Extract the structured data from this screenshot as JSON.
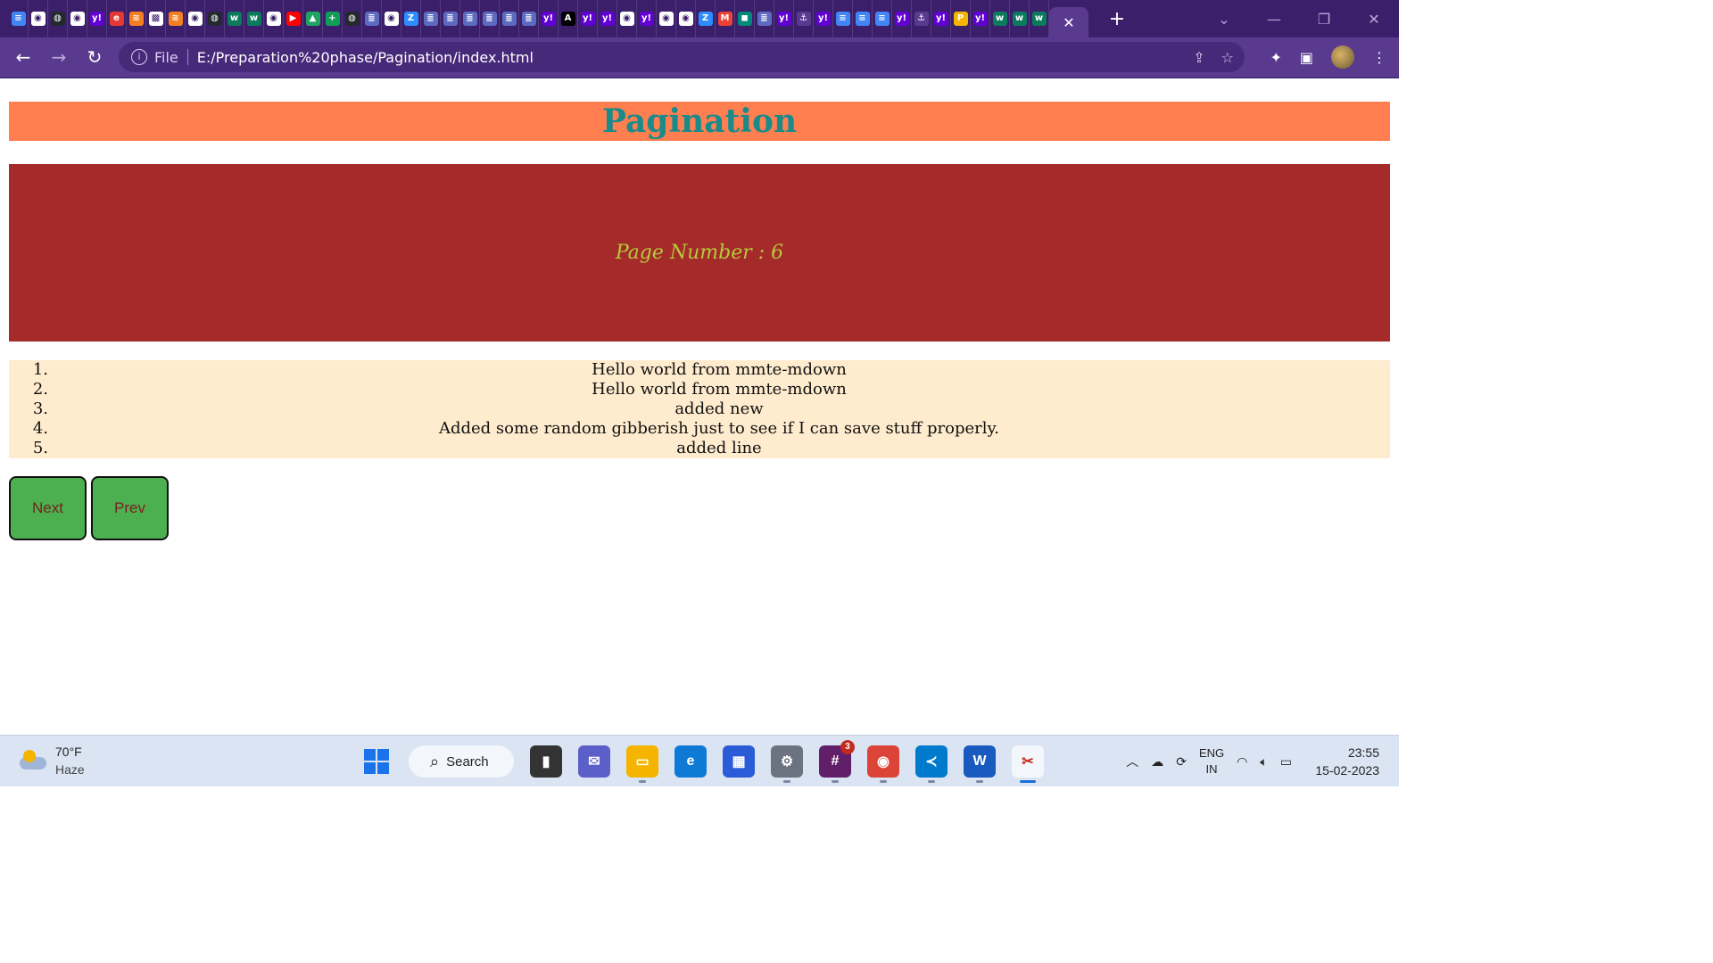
{
  "browser": {
    "favicons": [
      "docs",
      "chrome",
      "github",
      "chrome",
      "yahoo",
      "app",
      "stack",
      "qr",
      "stack",
      "chrome",
      "github",
      "w",
      "w",
      "chrome",
      "youtube",
      "drive",
      "plus",
      "github",
      "list",
      "chrome",
      "z",
      "list",
      "list",
      "list",
      "list",
      "list",
      "list",
      "yahoo",
      "a",
      "yahoo",
      "yahoo",
      "chrome",
      "yahoo",
      "chrome",
      "chrome",
      "z",
      "gmail",
      "meet",
      "list",
      "yahoo",
      "anchor",
      "yahoo",
      "docs",
      "docs",
      "docs",
      "yahoo",
      "anchor",
      "yahoo",
      "p",
      "yahoo",
      "w",
      "w",
      "w"
    ],
    "active_tab_close": "✕",
    "new_tab": "+",
    "scheme_label": "File",
    "url": "E:/Preparation%20phase/Pagination/index.html"
  },
  "page": {
    "title": "Pagination",
    "page_number_text": "Page Number : 6",
    "items": [
      {
        "num": "1.",
        "text": "Hello world from mmte-mdown"
      },
      {
        "num": "2.",
        "text": "Hello world from mmte-mdown"
      },
      {
        "num": "3.",
        "text": "added new"
      },
      {
        "num": "4.",
        "text": "Added some random gibberish just to see if I can save stuff properly."
      },
      {
        "num": "5.",
        "text": "added line"
      }
    ],
    "next_label": "Next",
    "prev_label": "Prev"
  },
  "taskbar": {
    "temperature": "70°F",
    "weather": "Haze",
    "search_label": "Search",
    "slack_badge": "3",
    "lang_top": "ENG",
    "lang_bottom": "IN",
    "time": "23:55",
    "date": "15-02-2023"
  },
  "colors": {
    "header_bg": "#ff7f50",
    "title_color": "#1a8a8a",
    "page_box_bg": "#a52a2a",
    "page_number_color": "#b5c93a",
    "list_bg": "#ffebcd",
    "button_bg": "#4caf50",
    "button_text": "#7a1f1f"
  }
}
